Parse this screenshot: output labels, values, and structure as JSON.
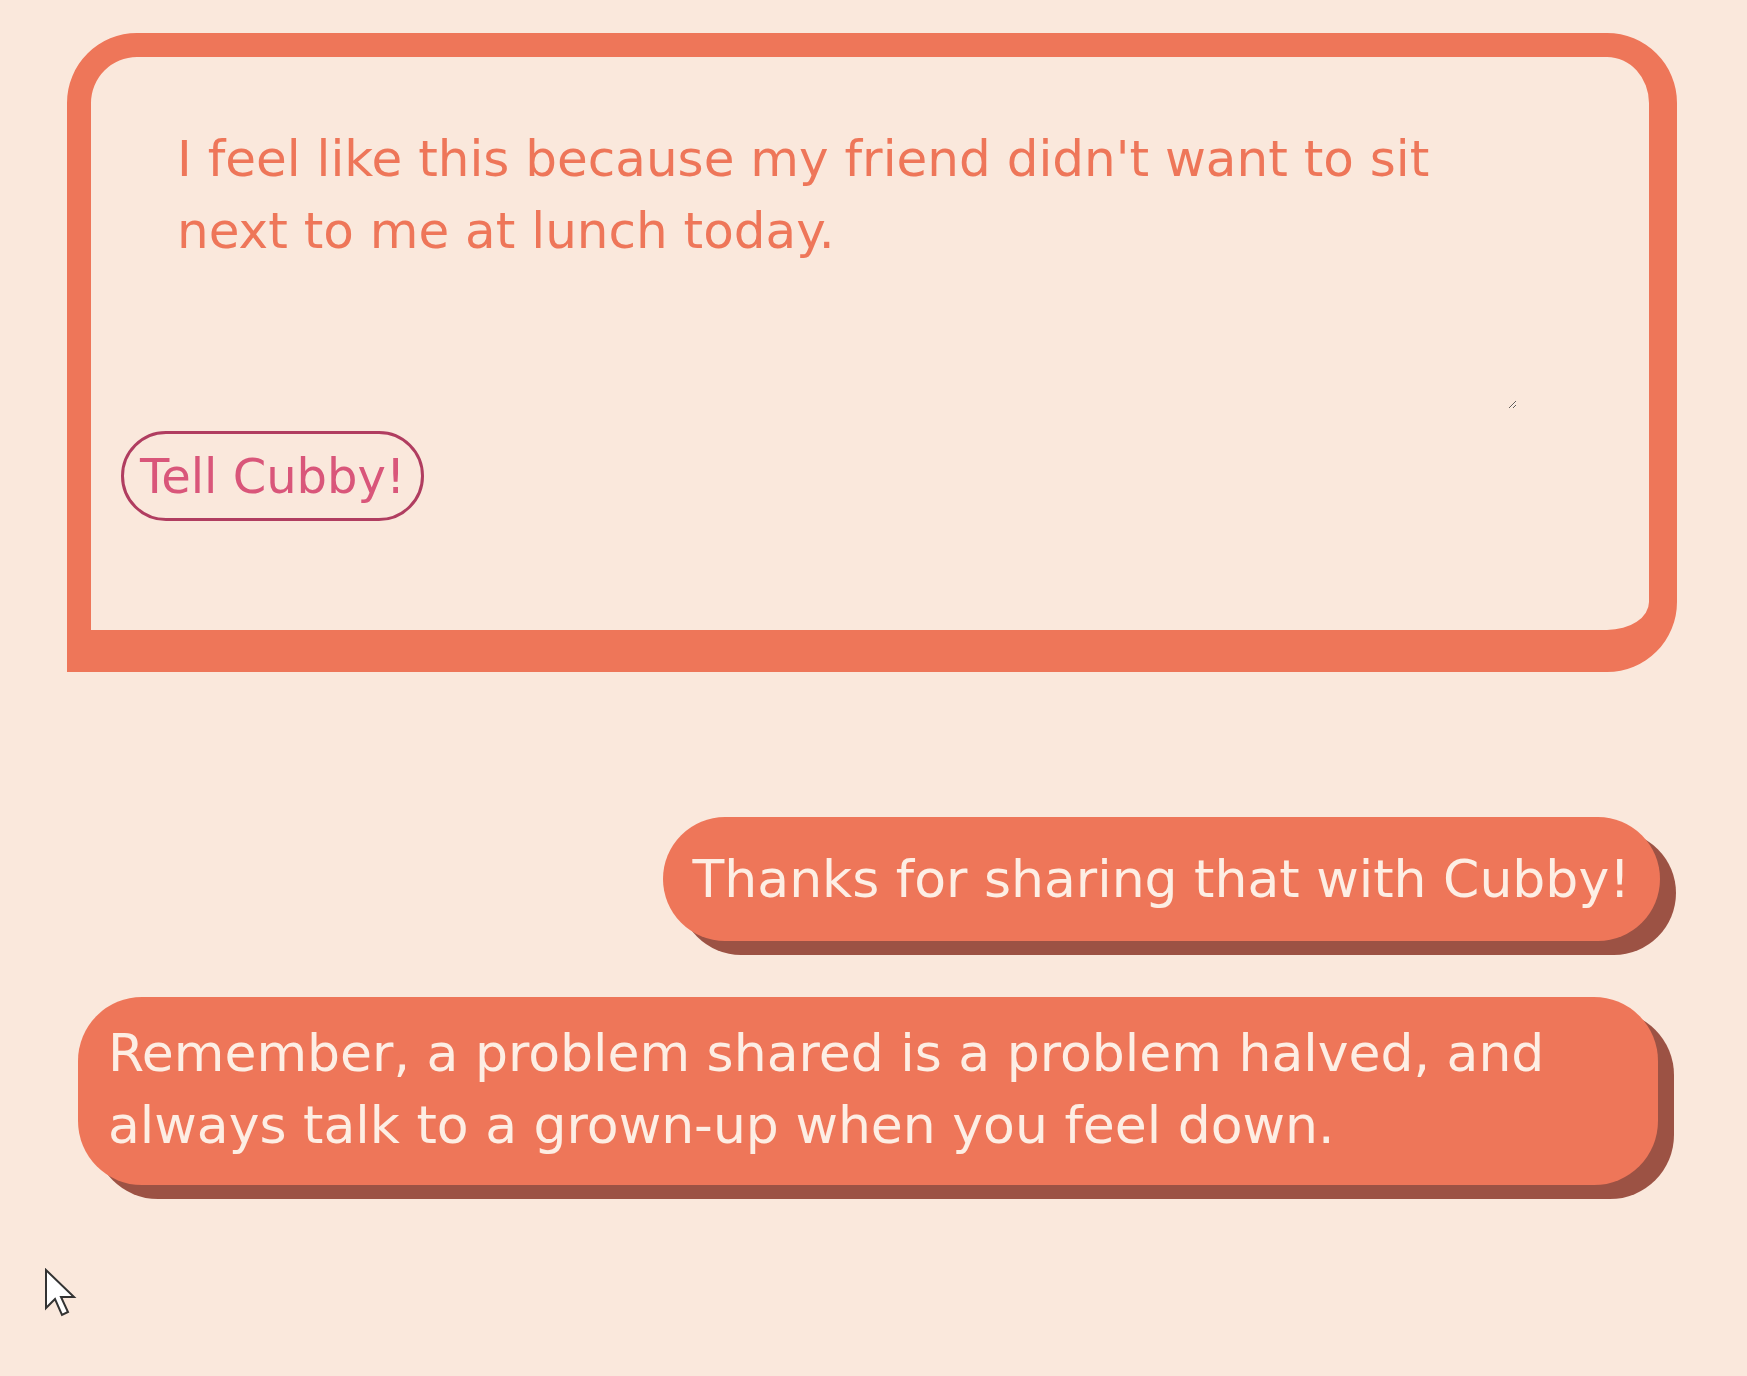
{
  "message_field": {
    "value": "I feel like this because my friend didn't want to sit next to me at lunch today."
  },
  "submit_button": {
    "label": "Tell Cubby!"
  },
  "messages": [
    {
      "text": "Thanks for sharing that with Cubby!",
      "kind": "short"
    },
    {
      "text": "Remember, a problem shared is a problem halved, and always talk to a grown-up when you feel down.",
      "kind": "long"
    }
  ]
}
